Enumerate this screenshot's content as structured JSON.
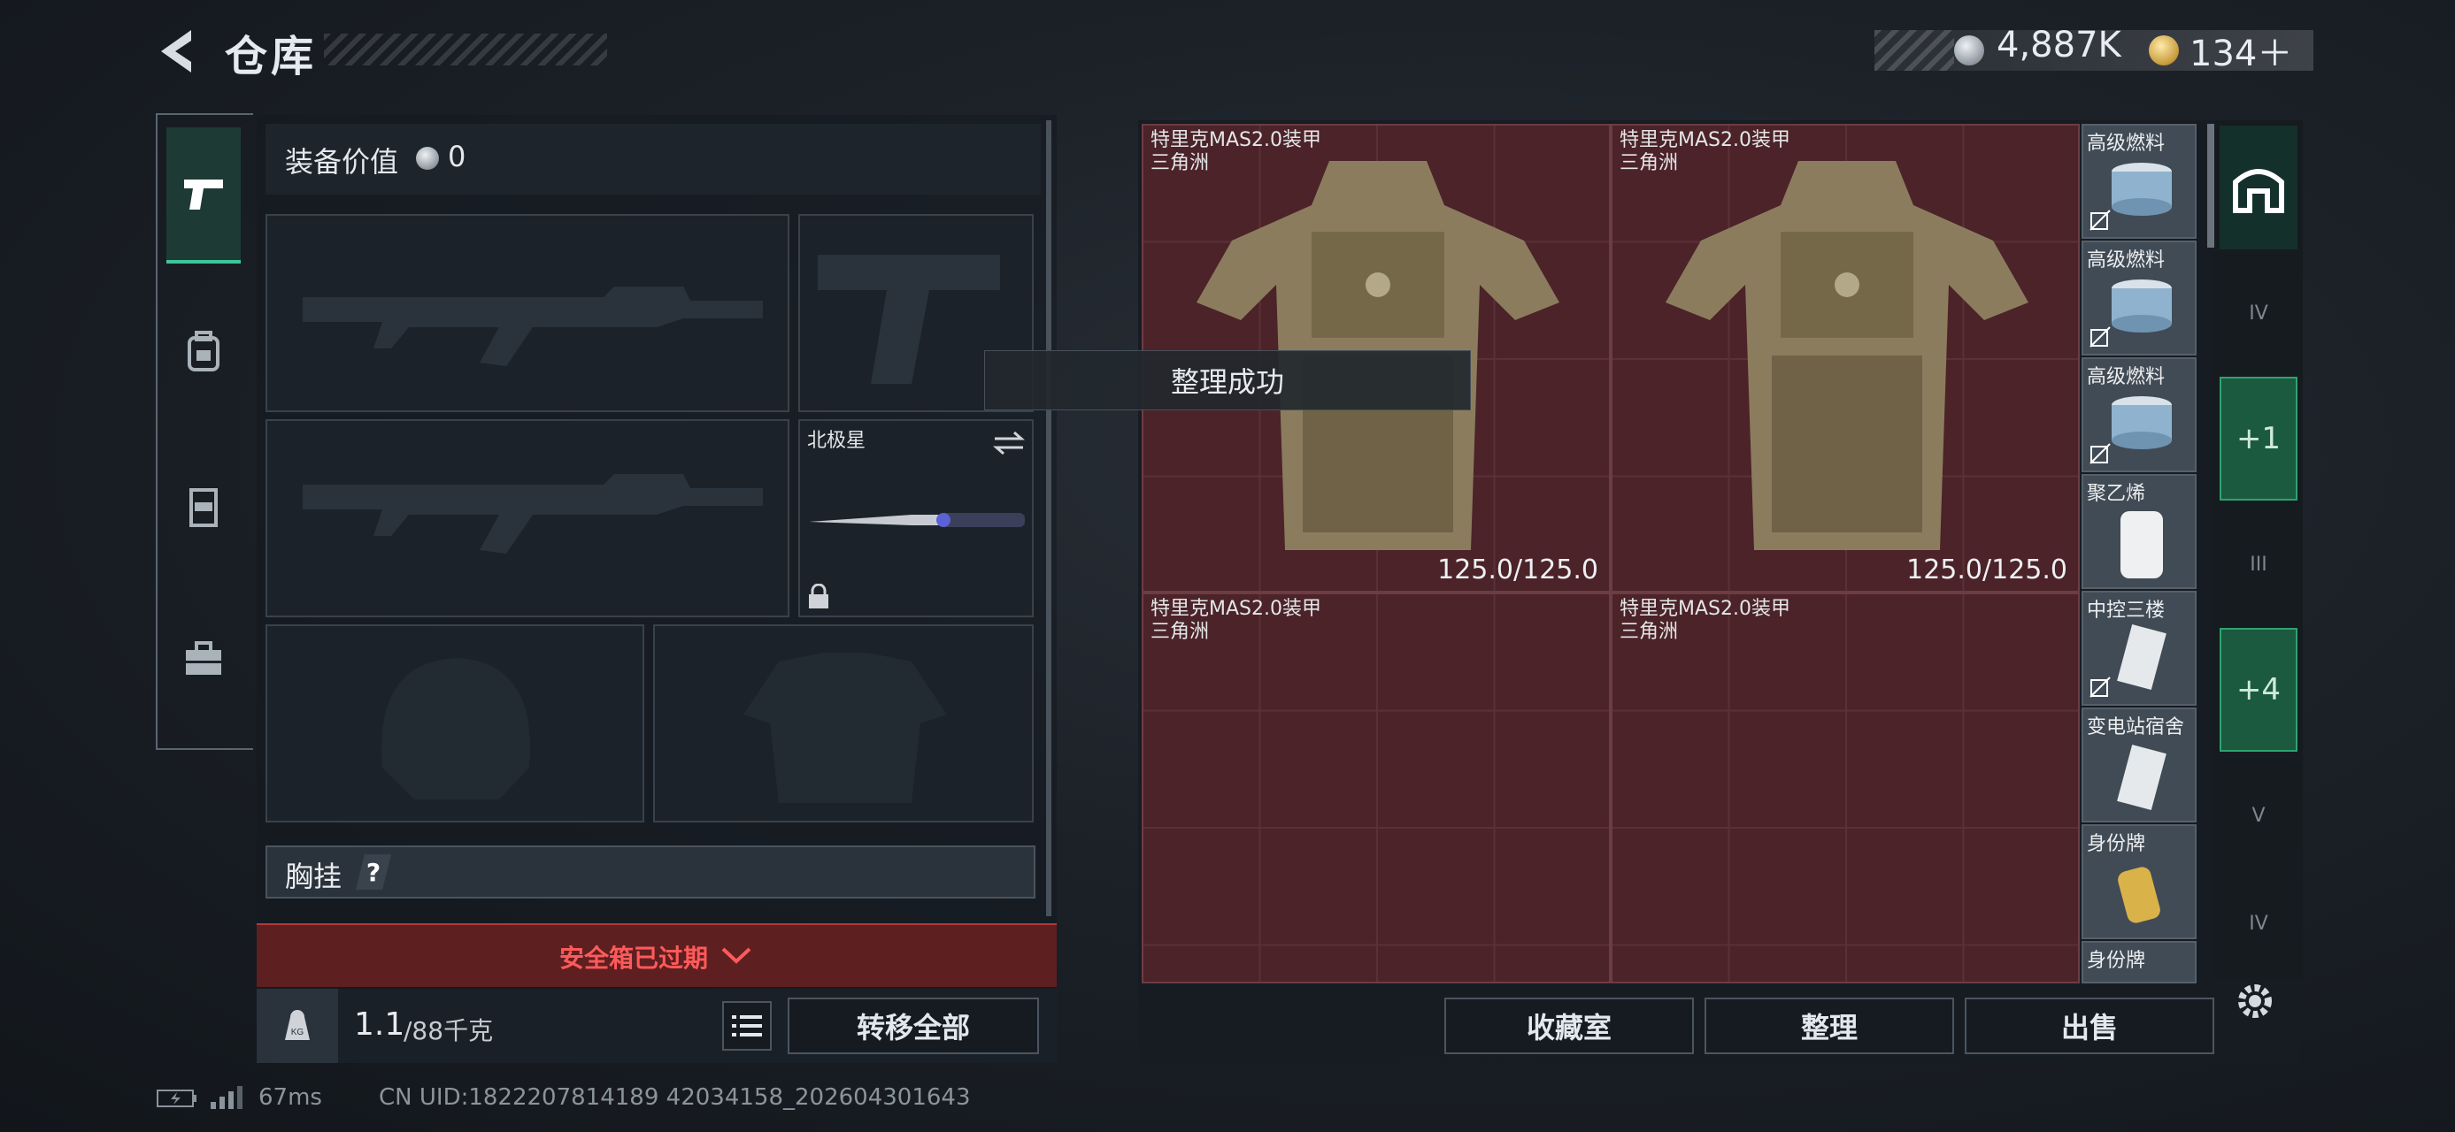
{
  "header": {
    "title": "仓库",
    "currency_silver": "4,887K",
    "currency_gold": "134＋"
  },
  "equipment": {
    "value_label": "装备价值",
    "value": "0",
    "melee_name": "北极星",
    "chest_label": "胸挂",
    "chest_help": "?",
    "safe_box_status": "安全箱已过期",
    "weight_current": "1.1",
    "weight_max": "/88千克",
    "transfer_all": "转移全部"
  },
  "stash": {
    "big_items": [
      {
        "name": "特里克MAS2.0装甲",
        "sub": "三角洲",
        "durability": "125.0/125.0"
      },
      {
        "name": "特里克MAS2.0装甲",
        "sub": "三角洲",
        "durability": "125.0/125.0"
      },
      {
        "name": "特里克MAS2.0装甲",
        "sub": "三角洲"
      },
      {
        "name": "特里克MAS2.0装甲",
        "sub": "三角洲"
      }
    ],
    "side_items": [
      "高级燃料",
      "高级燃料",
      "高级燃料",
      "聚乙烯",
      "中控三楼",
      "变电站宿舍",
      "身份牌",
      "身份牌"
    ],
    "rail_labels": [
      "IV",
      "+1",
      "III",
      "+4",
      "V",
      "IV"
    ],
    "buttons": {
      "collection": "收藏室",
      "sort": "整理",
      "sell": "出售"
    }
  },
  "toast": "整理成功",
  "status": {
    "ping": "67ms",
    "uid": "CN UID:1822207814189 42034158_202604301643"
  },
  "colors": {
    "accent_green": "#3fc59a",
    "stash_red": "#4b2329",
    "alert_red": "#e14a4a"
  }
}
